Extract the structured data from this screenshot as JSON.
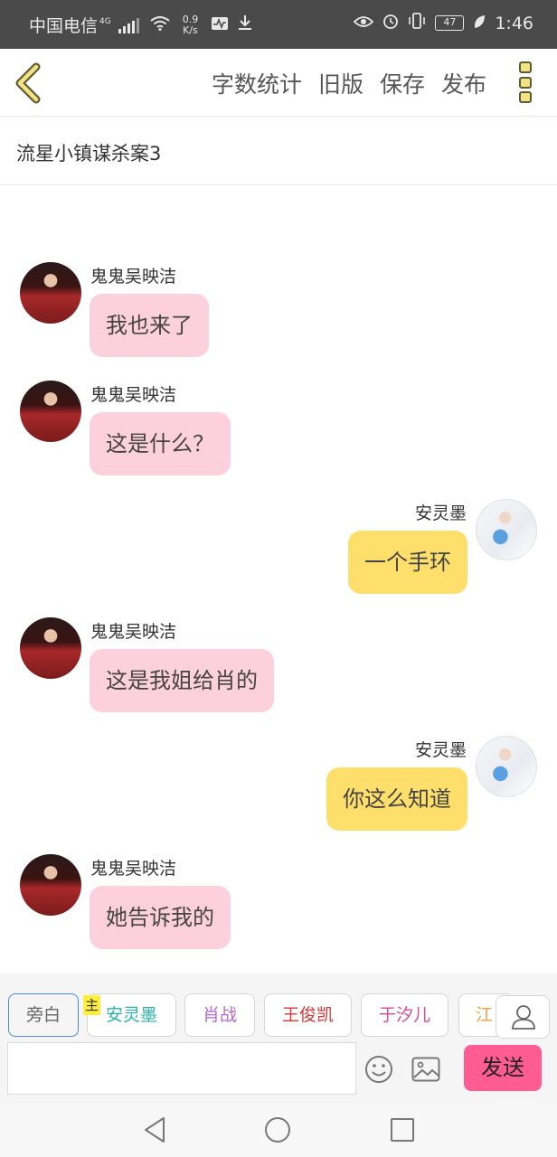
{
  "status_bar": {
    "carrier": "中国电信",
    "network_type": "4G",
    "speed_value": "0.9",
    "speed_unit": "K/s",
    "battery": "47",
    "time": "1:46"
  },
  "header": {
    "actions": [
      "字数统计",
      "旧版",
      "保存",
      "发布"
    ],
    "back_icon": "chevron-left-icon",
    "more_icon": "more-vertical-icon"
  },
  "title": "流星小镇谋杀案3",
  "messages": [
    {
      "side": "left",
      "name": "鬼鬼吴映洁",
      "text": "我也来了",
      "bubble_color": "#fdd0dd"
    },
    {
      "side": "left",
      "name": "鬼鬼吴映洁",
      "text": "这是什么？",
      "bubble_color": "#fdd0dd"
    },
    {
      "side": "right",
      "name": "安灵墨",
      "text": "一个手环",
      "bubble_color": "#fedf6c"
    },
    {
      "side": "left",
      "name": "鬼鬼吴映洁",
      "text": "这是我姐给肖的",
      "bubble_color": "#fdd0dd"
    },
    {
      "side": "right",
      "name": "安灵墨",
      "text": "你这么知道",
      "bubble_color": "#fedf6c"
    },
    {
      "side": "left",
      "name": "鬼鬼吴映洁",
      "text": "她告诉我的",
      "bubble_color": "#fdd0dd"
    }
  ],
  "roles": [
    {
      "label": "旁白",
      "color": "#666666",
      "active": true
    },
    {
      "label": "安灵墨",
      "color": "#2bb3a5"
    },
    {
      "label": "肖战",
      "color": "#b06ad0"
    },
    {
      "label": "王俊凯",
      "color": "#d23a3a"
    },
    {
      "label": "于汐儿",
      "color": "#d54a9a"
    },
    {
      "label": "江",
      "color": "#f0a040"
    }
  ],
  "host_tag": "主",
  "input": {
    "placeholder": ""
  },
  "send_label": "发送",
  "colors": {
    "send_button": "#ff5c93",
    "pink_bubble": "#fdd0dd",
    "yellow_bubble": "#fedf6c"
  }
}
